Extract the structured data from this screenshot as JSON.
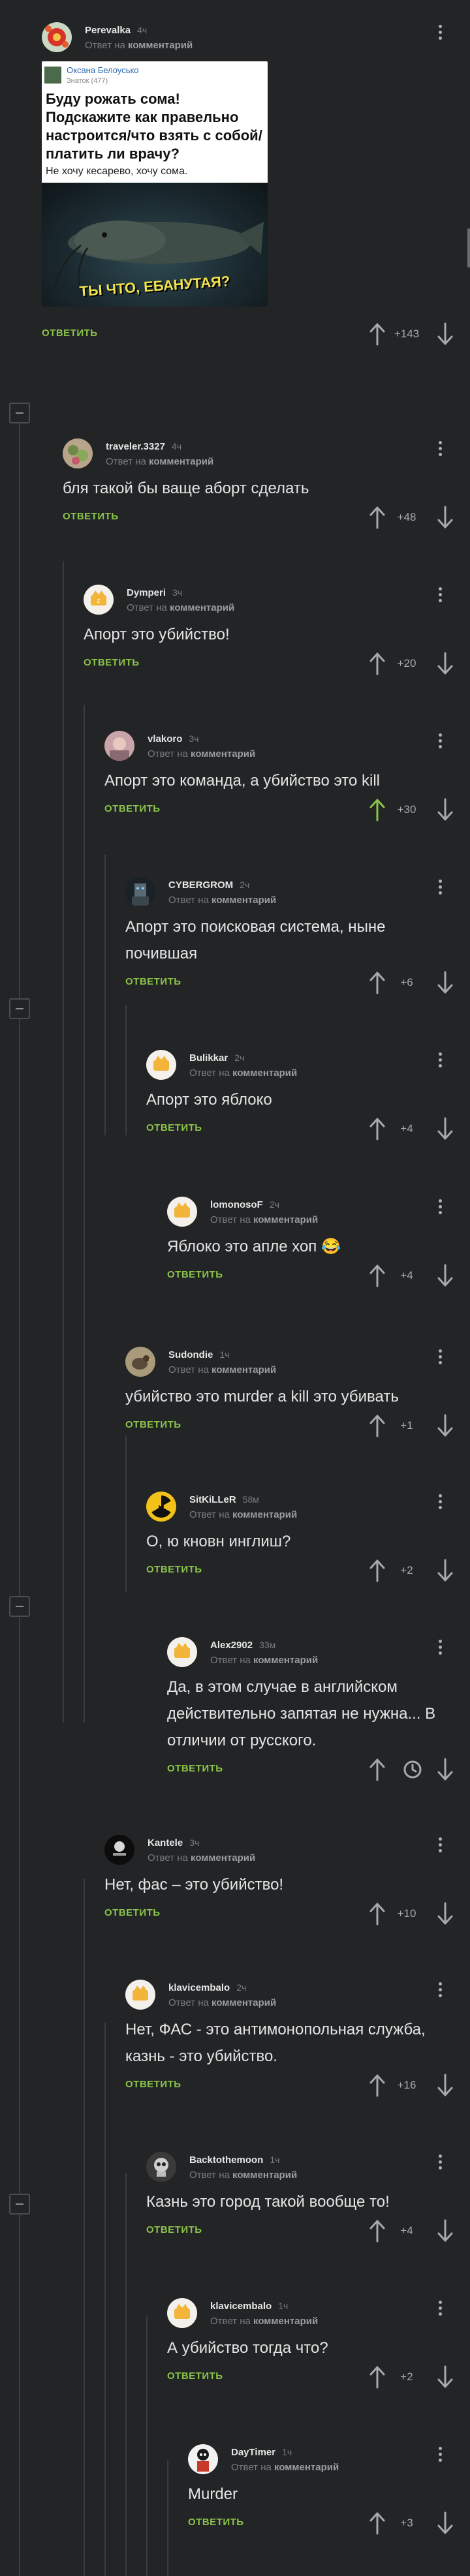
{
  "labels": {
    "reply_prefix": "Ответ на",
    "reply_target": "комментарий",
    "reply_button": "ОТВЕТИТЬ"
  },
  "colors": {
    "background": "#222426",
    "reply_green": "#8bc34a",
    "text": "#e4e4e4",
    "meta_gray": "#7a7d80"
  },
  "embedded_post": {
    "author": "Оксана Белоусько",
    "badge": "Знаток (477)",
    "title": "Буду рожать сома! Подскажите как правельно настроится/что взять с собой/платить ли врачу?",
    "body": "Не хочу кесарево, хочу сома.",
    "image_caption": "ТЫ ЧТО, ЕБАНУТАЯ?"
  },
  "comments": [
    {
      "user": "Perevalka",
      "time": "4ч",
      "avatar_icon": "flower-icon",
      "text": "",
      "score": "+143",
      "upvoted": false
    },
    {
      "user": "traveler.3327",
      "time": "4ч",
      "avatar_icon": "plant-icon",
      "text": "бля такой бы ваще аборт сделать",
      "score": "+48",
      "upvoted": false
    },
    {
      "user": "Dymperi",
      "time": "3ч",
      "avatar_icon": "default-avatar-icon",
      "text": "Апорт это убийство!",
      "score": "+20",
      "upvoted": false
    },
    {
      "user": "vlakoro",
      "time": "3ч",
      "avatar_icon": "photo-avatar-icon",
      "text": "Апорт это команда, а убийство это kill",
      "score": "+30",
      "upvoted": true
    },
    {
      "user": "CYBERGROM",
      "time": "2ч",
      "avatar_icon": "robot-avatar-icon",
      "text": "Апорт это поисковая система, ныне почившая",
      "score": "+6",
      "upvoted": false
    },
    {
      "user": "Bulikkar",
      "time": "2ч",
      "avatar_icon": "default-avatar-icon",
      "text": "Апорт это яблоко",
      "score": "+4",
      "upvoted": false
    },
    {
      "user": "lomonosoF",
      "time": "2ч",
      "avatar_icon": "default-avatar-icon",
      "text": "Яблоко это апле хоп 😂",
      "score": "+4",
      "upvoted": false
    },
    {
      "user": "Sudondie",
      "time": "1ч",
      "avatar_icon": "bird-avatar-icon",
      "text": "убийство это murder а kill это убивать",
      "score": "+1",
      "upvoted": false
    },
    {
      "user": "SitKiLLeR",
      "time": "58м",
      "avatar_icon": "radiation-icon",
      "text": "О, ю кновн инглиш?",
      "score": "+2",
      "upvoted": false
    },
    {
      "user": "Alex2902",
      "time": "33м",
      "avatar_icon": "default-avatar-icon",
      "text": "Да, в этом случае в английском действительно запятая не нужна... В отличии от русского.",
      "score": "",
      "upvoted": false
    },
    {
      "user": "Kantele",
      "time": "3ч",
      "avatar_icon": "dark-avatar-icon",
      "text": "Нет, фас – это убийство!",
      "score": "+10",
      "upvoted": false
    },
    {
      "user": "klavicembalo",
      "time": "2ч",
      "avatar_icon": "default-avatar-icon",
      "text": "Нет, ФАС - это антимонопольная служба, казнь - это убийство.",
      "score": "+16",
      "upvoted": false
    },
    {
      "user": "Backtothemoon",
      "time": "1ч",
      "avatar_icon": "skull-avatar-icon",
      "text": "Казнь это город такой вообще то!",
      "score": "+4",
      "upvoted": false
    },
    {
      "user": "klavicembalo",
      "time": "1ч",
      "avatar_icon": "default-avatar-icon",
      "text": "А убийство тогда что?",
      "score": "+2",
      "upvoted": false
    },
    {
      "user": "DayTimer",
      "time": "1ч",
      "avatar_icon": "character-avatar-icon",
      "text": "Murder",
      "score": "+3",
      "upvoted": false
    }
  ]
}
